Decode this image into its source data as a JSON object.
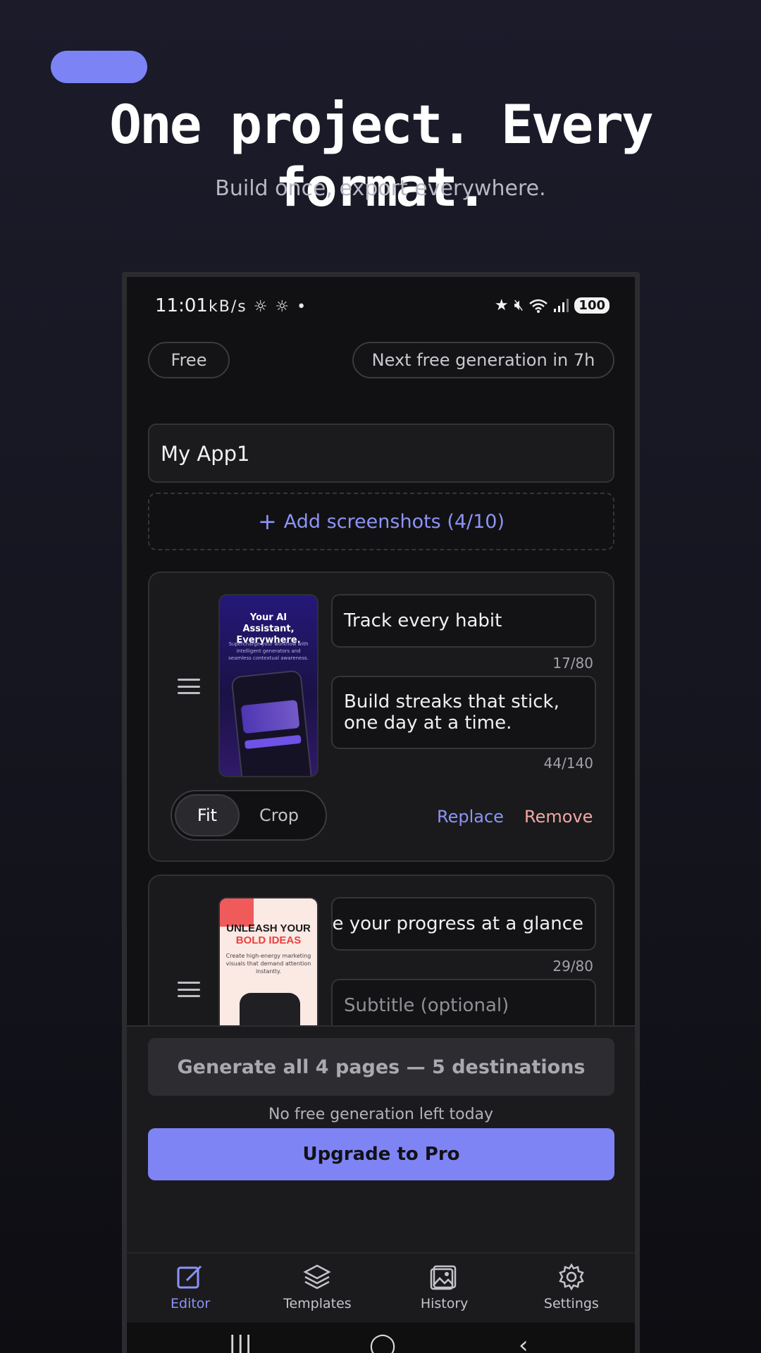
{
  "hero": {
    "headline": "One project. Every format.",
    "subhead": "Build once, export everywhere."
  },
  "status": {
    "time": "11:01",
    "left_icons": "kB/s ☼ ☼ •",
    "battery": "100"
  },
  "chips": {
    "plan": "Free",
    "next_generation": "Next free generation in 7h"
  },
  "project": {
    "name_value": "My App1",
    "add_screenshots": "Add screenshots (4/10)"
  },
  "cards": [
    {
      "thumb_title": "Your AI Assistant, Everywhere.",
      "thumb_sub": "Supercharge your workflow with intelligent generators and seamless contextual awareness.",
      "title_value": "Track every habit",
      "title_counter": "17/80",
      "subtitle_value": "Build streaks that stick, one day at a time.",
      "subtitle_counter": "44/140",
      "fit_label": "Fit",
      "crop_label": "Crop",
      "replace_label": "Replace",
      "remove_label": "Remove"
    },
    {
      "thumb_title_a": "UNLEASH YOUR",
      "thumb_title_b": "BOLD IDEAS",
      "thumb_sub": "Create high-energy marketing visuals that demand attention instantly.",
      "title_value": "See your progress at a glance",
      "title_counter": "29/80",
      "subtitle_placeholder": "Subtitle (optional)"
    }
  ],
  "actions": {
    "generate": "Generate all 4 pages — 5 destinations",
    "no_free": "No free generation left today",
    "upgrade": "Upgrade to Pro"
  },
  "nav": [
    {
      "label": "Editor",
      "icon": "edit-icon"
    },
    {
      "label": "Templates",
      "icon": "layers-icon"
    },
    {
      "label": "History",
      "icon": "gallery-icon"
    },
    {
      "label": "Settings",
      "icon": "gear-icon"
    }
  ],
  "colors": {
    "accent": "#7f84f5",
    "remove": "#f0a8a2"
  }
}
